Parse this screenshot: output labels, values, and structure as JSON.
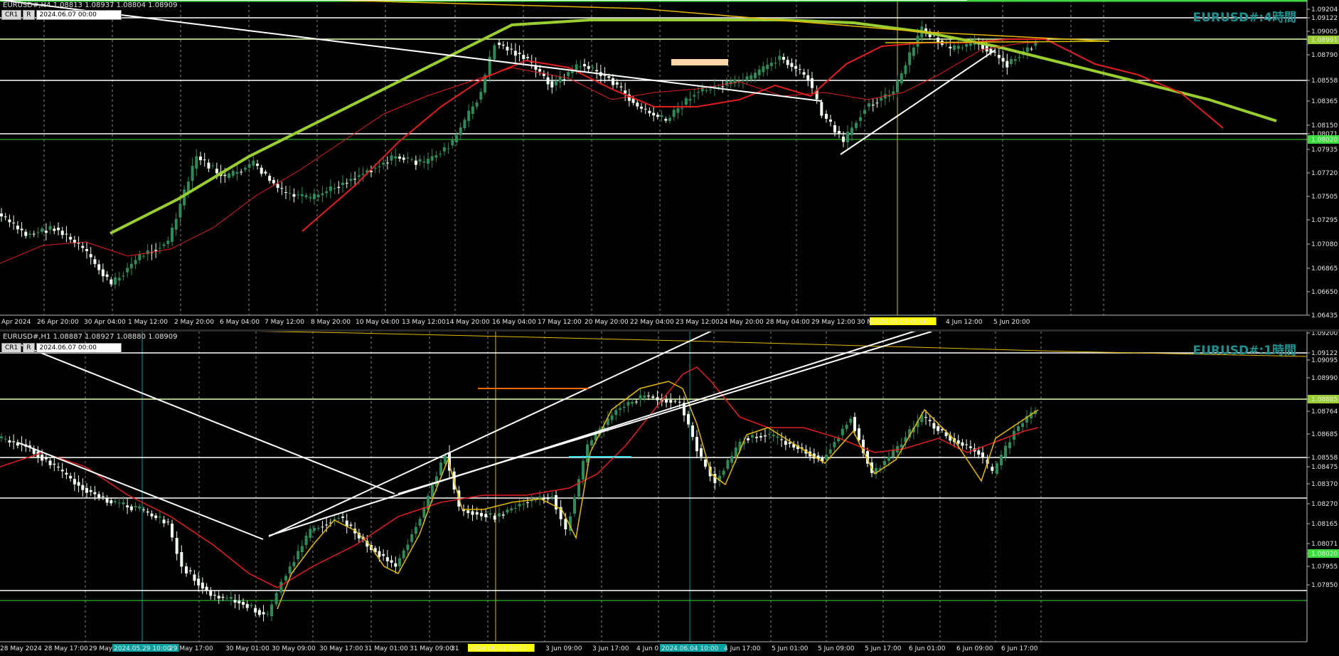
{
  "h4": {
    "info_line": "EURUSD#,H4  1.08813 1.08937 1.08804 1.08909",
    "ctrl_cr": "CR1",
    "ctrl_r": "R",
    "ctrl_datetime": "2024.06.07 00:00",
    "watermark": "EURUSD#:4時間",
    "price_labels": [
      "1.09204",
      "1.09122",
      "1.09005",
      "1.08991",
      "1.08790",
      "1.08558",
      "1.08365",
      "1.08150",
      "1.08071",
      "1.08020",
      "1.07935",
      "1.07720",
      "1.07505",
      "1.07295",
      "1.07080",
      "1.06865",
      "1.06650",
      "1.06435"
    ],
    "time_labels": [
      "Apr 2024",
      "26 Apr 20:00",
      "30 Apr 04:00",
      "1 May 12:00",
      "2 May 20:00",
      "6 May 04:00",
      "7 May 12:00",
      "8 May 20:00",
      "10 May 04:00",
      "13 May 12:00",
      "14 May 20:00",
      "16 May 04:00",
      "17 May 12:00",
      "20 May 20:00",
      "22 May 04:00",
      "23 May 12:00",
      "24 May 20:00",
      "28 May 04:00",
      "29 May 12:00",
      "30 M",
      "2024.06.03 00:00",
      "4 Jun 12:00",
      "5 Jun 20:00"
    ],
    "highlight_time": "2024.06.03 00:00"
  },
  "h1": {
    "info_line": "EURUSD#,H1  1.08887 1.08927 1.08880 1.08909",
    "ctrl_cr": "CR1",
    "ctrl_r": "R",
    "ctrl_datetime": "2024.06.07 00:00",
    "watermark": "EURUSD#:1時間",
    "price_labels": [
      "1.09200",
      "1.09122",
      "1.09095",
      "1.08990",
      "1.08885",
      "1.08764",
      "1.08685",
      "1.08558",
      "1.08475",
      "1.08370",
      "1.08270",
      "1.08165",
      "1.08071",
      "1.08020",
      "1.07955",
      "1.07850"
    ],
    "time_labels": [
      "28 May 2024",
      "28 May 17:00",
      "29 May",
      "2024.05.29 10:00",
      "29 May 17:00",
      "30 May 01:00",
      "30 May 09:00",
      "30 May 17:00",
      "31 May 01:00",
      "31 May 09:00",
      "31",
      "2024.06.03 00:00",
      "3 Jun 09:00",
      "3 Jun 17:00",
      "4 Jun 0",
      "2024.06.04 10:00",
      "4 Jun 17:00",
      "5 Jun 01:00",
      "5 Jun 09:00",
      "5 Jun 17:00",
      "6 Jun 01:00",
      "6 Jun 09:00",
      "6 Jun 17:00"
    ],
    "highlight_time_1": "2024.05.29 10:00",
    "highlight_time_2": "2024.06.03 00:00",
    "highlight_time_3": "2024.06.04 10:00"
  },
  "colors": {
    "background": "#000000",
    "bull": "#2e8b57",
    "bear": "#f0fff0",
    "ma_red": "#e02020",
    "ma_green": "#9acd32",
    "ma_yellow": "#e6b800",
    "level_line": "#ffffff",
    "highlight_bg": "#ffff00",
    "highlight_bg_2": "#00a0a0",
    "peach_box": "#ffd7a8"
  }
}
